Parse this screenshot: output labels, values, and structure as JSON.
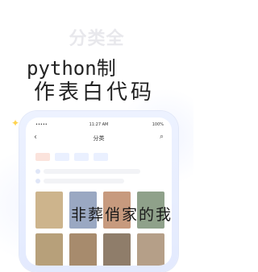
{
  "hero": {
    "title": "分类全"
  },
  "overlay": {
    "line1": "python制",
    "line2": "作表白代码",
    "bottom": "非葬俏家的我"
  },
  "phone": {
    "status": {
      "carrier": "•••••",
      "time": "11:27 AM",
      "battery": "100%"
    },
    "nav": {
      "back_icon": "chevron-left-icon",
      "title": "分类",
      "search_icon": "search-icon"
    },
    "chips": [
      "",
      "",
      "",
      ""
    ]
  },
  "colors": {
    "accent": "#5a7de0",
    "chip_hot": "#e26b4a",
    "sparkle": "#ffd34d"
  }
}
